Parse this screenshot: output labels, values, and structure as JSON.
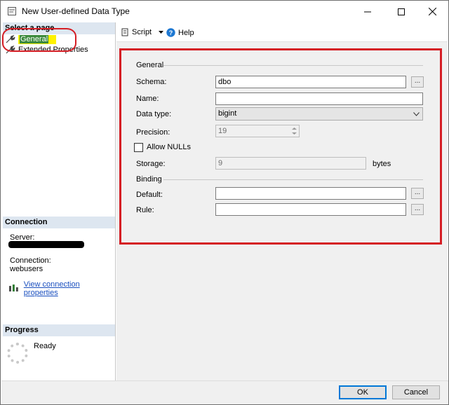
{
  "window": {
    "title": "New User-defined Data Type"
  },
  "left": {
    "select_page_header": "Select a page",
    "pages": [
      "General",
      "Extended Properties"
    ],
    "connection_header": "Connection",
    "server_label": "Server:",
    "connection_label": "Connection:",
    "connection_value": "webusers",
    "view_connection_link": "View connection properties",
    "progress_header": "Progress",
    "progress_status": "Ready"
  },
  "toolbar": {
    "script_label": "Script",
    "help_label": "Help"
  },
  "form": {
    "general_group": "General",
    "schema_label": "Schema:",
    "schema_value": "dbo",
    "name_label": "Name:",
    "name_value": "",
    "datatype_label": "Data type:",
    "datatype_value": "bigint",
    "precision_label": "Precision:",
    "precision_value": "19",
    "allow_nulls_label": "Allow NULLs",
    "allow_nulls_checked": false,
    "storage_label": "Storage:",
    "storage_value": "9",
    "storage_unit": "bytes",
    "binding_group": "Binding",
    "default_label": "Default:",
    "default_value": "",
    "rule_label": "Rule:",
    "rule_value": "",
    "browse_label": "..."
  },
  "buttons": {
    "ok": "OK",
    "cancel": "Cancel"
  },
  "colors": {
    "highlight_yellow": "#fff200",
    "annotation_red": "#d51d24",
    "header_blue": "#dde6f0",
    "link_blue": "#1a4fbf",
    "focus_blue": "#0078d7"
  }
}
